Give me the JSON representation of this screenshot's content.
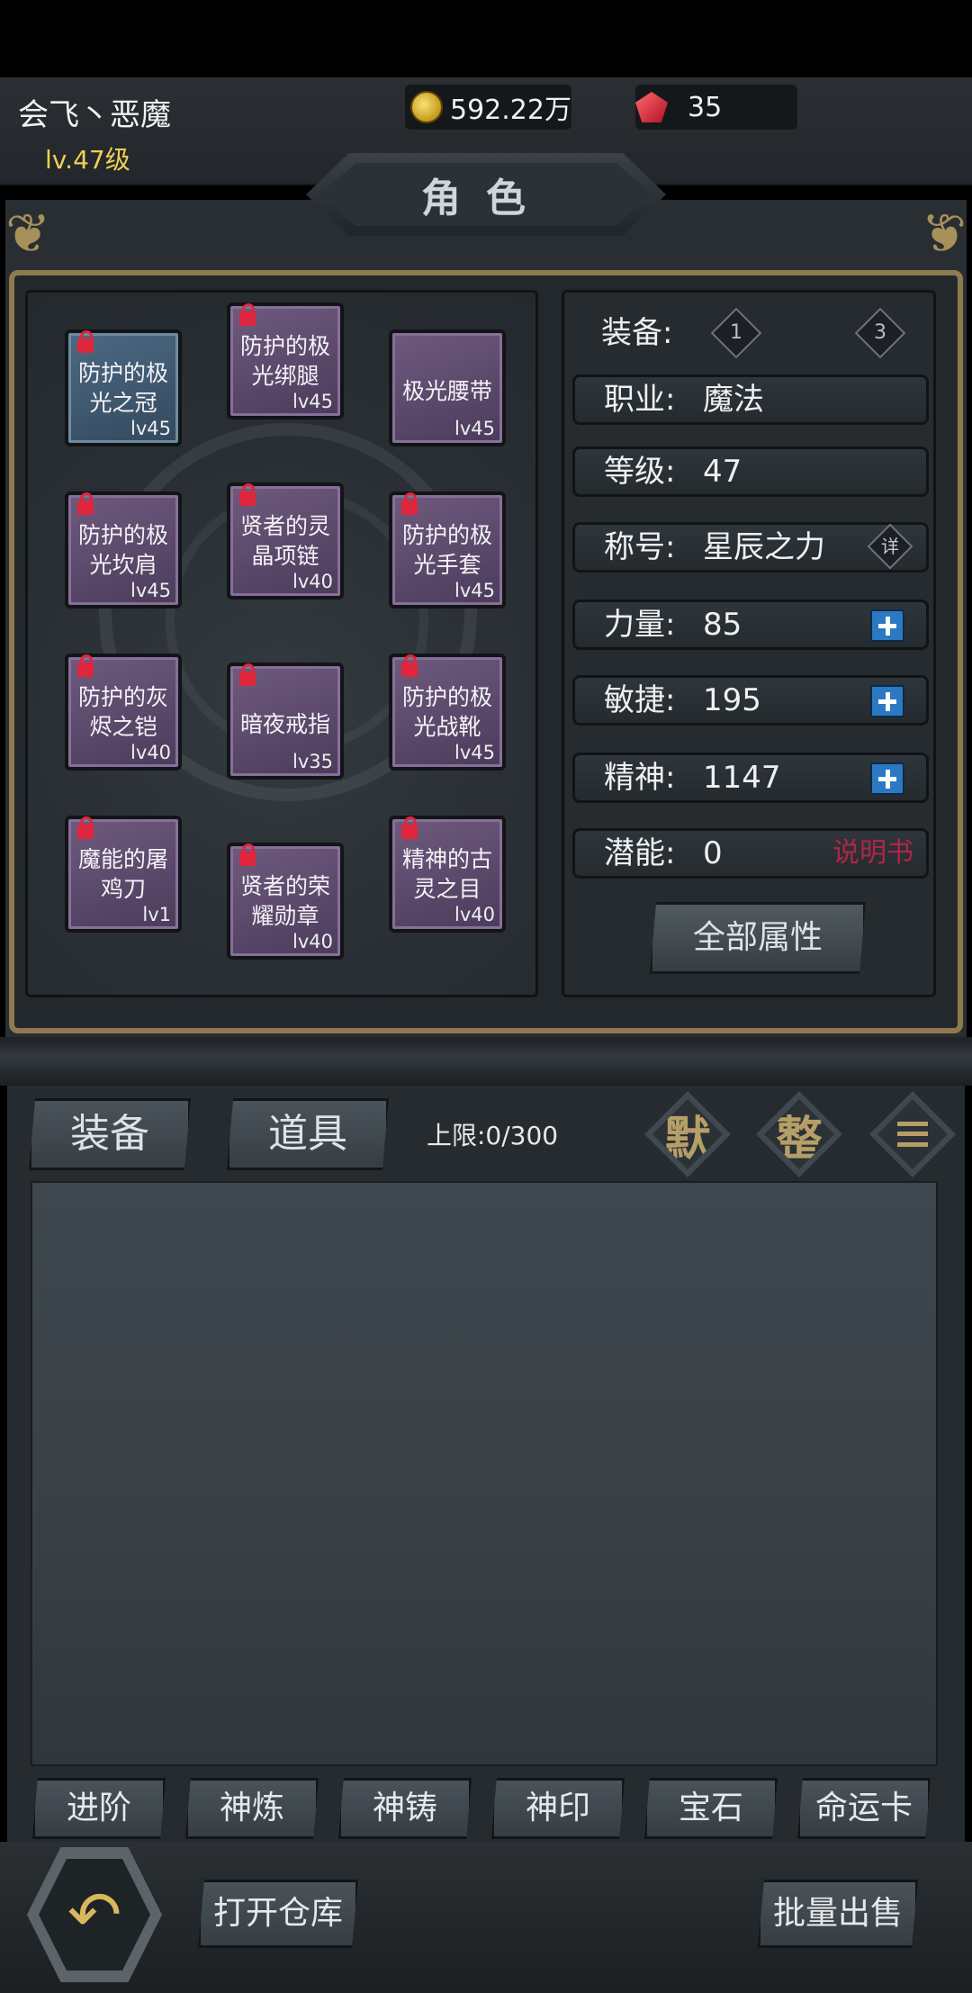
{
  "header": {
    "player_name": "会飞丶恶魔",
    "level": "lv.47级",
    "gold": "592.22万",
    "gems": "35"
  },
  "title": "角色",
  "equipment": [
    {
      "name": "防护的极光之冠",
      "lv": "lv45",
      "locked": true,
      "rarity": "blue"
    },
    {
      "name": "防护的极光绑腿",
      "lv": "lv45",
      "locked": true,
      "rarity": "purple"
    },
    {
      "name": "极光腰带",
      "lv": "lv45",
      "locked": false,
      "rarity": "purple"
    },
    {
      "name": "防护的极光坎肩",
      "lv": "lv45",
      "locked": true,
      "rarity": "purple"
    },
    {
      "name": "贤者的灵晶项链",
      "lv": "lv40",
      "locked": true,
      "rarity": "purple"
    },
    {
      "name": "防护的极光手套",
      "lv": "lv45",
      "locked": true,
      "rarity": "purple"
    },
    {
      "name": "防护的灰烬之铠",
      "lv": "lv40",
      "locked": true,
      "rarity": "purple"
    },
    {
      "name": "暗夜戒指",
      "lv": "lv35",
      "locked": true,
      "rarity": "purple"
    },
    {
      "name": "防护的极光战靴",
      "lv": "lv45",
      "locked": true,
      "rarity": "purple"
    },
    {
      "name": "魔能的屠鸡刀",
      "lv": "lv1",
      "locked": true,
      "rarity": "purple"
    },
    {
      "name": "贤者的荣耀勋章",
      "lv": "lv40",
      "locked": true,
      "rarity": "purple"
    },
    {
      "name": "精神的古灵之目",
      "lv": "lv40",
      "locked": true,
      "rarity": "purple"
    }
  ],
  "stats": {
    "equip_label": "装备:",
    "equip_set_1": "1",
    "equip_set_3": "3",
    "class_label": "职业:",
    "class_value": "魔法",
    "level_label": "等级:",
    "level_value": "47",
    "title_label": "称号:",
    "title_value": "星辰之力",
    "detail_label": "详",
    "strength_label": "力量:",
    "strength_value": "85",
    "agility_label": "敏捷:",
    "agility_value": "195",
    "spirit_label": "精神:",
    "spirit_value": "1147",
    "potential_label": "潜能:",
    "potential_value": "0",
    "manual_link": "说明书",
    "all_attributes": "全部属性"
  },
  "inventory": {
    "tab_equipment": "装备",
    "tab_items": "道具",
    "capacity": "上限:0/300",
    "default_button": "默",
    "sort_button": "整"
  },
  "functions": [
    "进阶",
    "神炼",
    "神铸",
    "神印",
    "宝石",
    "命运卡"
  ],
  "bottom": {
    "open_warehouse": "打开仓库",
    "bulk_sell": "批量出售"
  },
  "colors": {
    "frame_gold": "#8f7a4f",
    "level_yellow": "#f0cf55",
    "plus_blue": "#2b79c2",
    "manual_red": "#b12547",
    "lock_red": "#e0263c"
  }
}
